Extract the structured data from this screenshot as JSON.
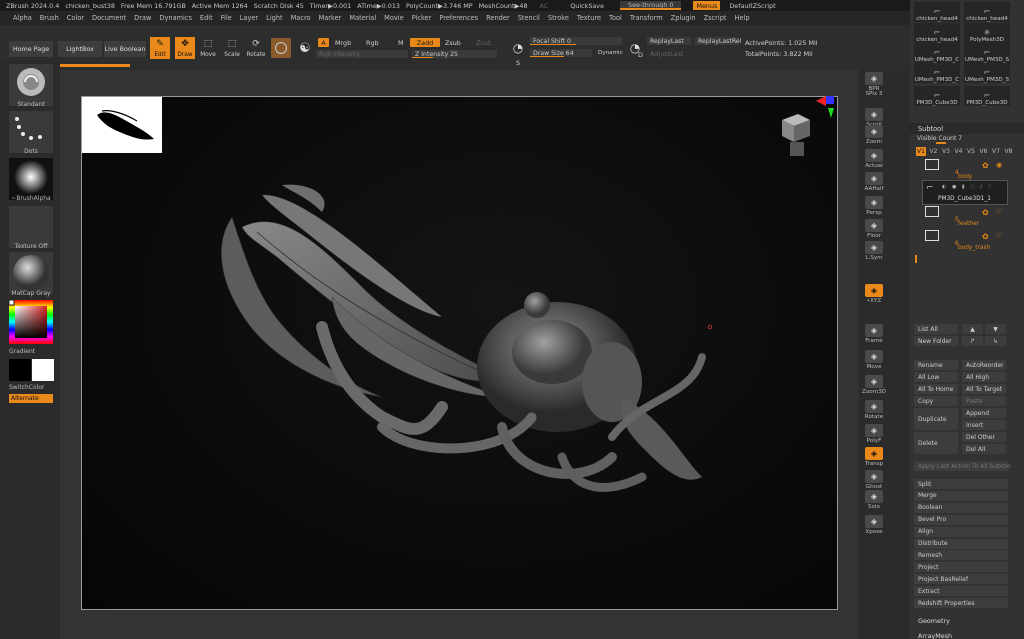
{
  "titlebar": {
    "app": "ZBrush 2024.0.4",
    "file": "chicken_bust38",
    "free_mem": "Free Mem 16.791GB",
    "active_mem": "Active Mem 1264",
    "scratch_disk": "Scratch Disk 45",
    "timer": "Timer▶0.001",
    "atime": "ATime▶0.013",
    "polycount": "PolyCount▶3.746 MP",
    "meshcount": "MeshCount▶48",
    "ac": "AC",
    "quicksave": "QuickSave",
    "seethrough": "See-through   0",
    "menus": "Menus",
    "default_zscript": "DefaultZScript"
  },
  "menubar": [
    "Alpha",
    "Brush",
    "Color",
    "Document",
    "Draw",
    "Dynamics",
    "Edit",
    "File",
    "Layer",
    "Light",
    "Macro",
    "Marker",
    "Material",
    "Movie",
    "Picker",
    "Preferences",
    "Render",
    "Stencil",
    "Stroke",
    "Texture",
    "Tool",
    "Transform",
    "Zplugin",
    "Zscript",
    "Help"
  ],
  "toolbar": {
    "home_page": "Home Page",
    "lightbox": "LightBox",
    "live_boolean": "Live Boolean",
    "edit": "Edit",
    "draw": "Draw",
    "move": "Move",
    "scale": "Scale",
    "rotate": "Rotate",
    "a_label": "A",
    "mrgb": "Mrgb",
    "rgb": "Rgb",
    "m": "M",
    "zadd": "Zadd",
    "zsub": "Zsub",
    "zcut": "Zcut",
    "rgb_intensity": "Rgb Intensity",
    "z_intensity": "Z Intensity 25",
    "focal_shift": "Focal Shift 0",
    "draw_size": "Draw Size 64",
    "dynamic": "Dynamic",
    "s_label": "S",
    "d_label": "D",
    "replay_last": "ReplayLast",
    "replay_last_rel": "ReplayLastRel",
    "adjust_last": "AdjustLast",
    "active_points": "ActivePoints: 1.025 Mil",
    "total_points": "TotalPoints: 3.822 Mil",
    "z_intensity_level": 0.25,
    "focal_shift_level": 0.5,
    "draw_size_level": 0.55
  },
  "leftshelf": {
    "standard": "Standard",
    "dots": "Dots",
    "brush_alpha": "~BrushAlpha",
    "texture_off": "Texture Off",
    "matcap": "MatCap Gray",
    "gradient": "Gradient",
    "switch_color": "SwitchColor",
    "alternate": "Alternate"
  },
  "rightshelf": [
    {
      "name": "bpr",
      "label": "BPR",
      "icon": "sphere-icon"
    },
    {
      "name": "spix",
      "label": "SPix 3",
      "icon": ""
    },
    {
      "name": "scroll",
      "label": "Scroll",
      "icon": "scroll-icon"
    },
    {
      "name": "zoom",
      "label": "Zoom",
      "icon": "zoom-icon"
    },
    {
      "name": "actual",
      "label": "Actual",
      "icon": "actual-icon"
    },
    {
      "name": "aahalf",
      "label": "AAHalf",
      "icon": "aahalf-icon"
    },
    {
      "name": "persp",
      "label": "Persp",
      "icon": "persp-icon"
    },
    {
      "name": "floor",
      "label": "Floor",
      "icon": "floor-icon"
    },
    {
      "name": "lsym",
      "label": "L.Sym",
      "icon": "lsym-icon"
    },
    {
      "name": "xyz",
      "label": "•XYZ",
      "icon": "xyz-icon"
    },
    {
      "name": "frame",
      "label": "Frame",
      "icon": "frame-icon"
    },
    {
      "name": "move",
      "label": "Move",
      "icon": "move-icon"
    },
    {
      "name": "zoom3d",
      "label": "Zoom3D",
      "icon": "zoom3d-icon"
    },
    {
      "name": "rotate",
      "label": "Rotate",
      "icon": "rotate-icon"
    },
    {
      "name": "polyf",
      "label": "PolyF",
      "icon": "polyf-icon"
    },
    {
      "name": "transp",
      "label": "Transp",
      "icon": "transp-icon"
    },
    {
      "name": "ghost",
      "label": "Ghost",
      "icon": "ghost-icon"
    },
    {
      "name": "solo",
      "label": "Solo",
      "icon": "solo-icon"
    },
    {
      "name": "xpose",
      "label": "Xpose",
      "icon": "xpose-icon"
    }
  ],
  "tool_thumbs": [
    {
      "label": "chicken_head4",
      "icon": "tool-icon"
    },
    {
      "label": "chicken_head4",
      "icon": "tool-icon"
    },
    {
      "label": "chicken_head4",
      "icon": "tool-icon"
    },
    {
      "label": "PolyMesh3D",
      "icon": "star-icon"
    },
    {
      "label": "UMesh_PM3D_C",
      "icon": "tool-icon"
    },
    {
      "label": "UMesh_PM3D_S",
      "icon": "tool-icon"
    },
    {
      "label": "UMesh_PM3D_C",
      "icon": "tool-icon"
    },
    {
      "label": "UMesh_PM3D_S",
      "icon": "tool-icon"
    },
    {
      "label": "PM3D_Cube3D",
      "icon": "tool-icon"
    },
    {
      "label": "PM3D_Cube3D",
      "icon": "tool-icon"
    }
  ],
  "subtool": {
    "header": "Subtool",
    "visible_count": "Visible Count 7",
    "versions": [
      "V1",
      "V2",
      "V3",
      "V4",
      "V5",
      "V6",
      "V7",
      "V8"
    ],
    "folders": [
      {
        "num": "4",
        "name": "body"
      },
      {
        "num": "5",
        "name": "feather"
      },
      {
        "num": "6",
        "name": "body_trash"
      }
    ],
    "active_item": "PM3D_Cube3D1_1",
    "list_all": "List All",
    "new_folder": "New Folder",
    "rename": "Rename",
    "autoreorder": "AutoReorder",
    "all_low": "All Low",
    "all_high": "All High",
    "all_to_home": "All To Home",
    "all_to_target": "All To Target",
    "copy": "Copy",
    "paste": "Paste",
    "duplicate": "Duplicate",
    "append": "Append",
    "insert": "Insert",
    "delete": "Delete",
    "del_other": "Del Other",
    "del_all": "Del All",
    "apply_last": "Apply Last Action To All Subtoo",
    "actions": [
      "Split",
      "Merge",
      "Boolean",
      "Bevel Pro",
      "Align",
      "Distribute",
      "Remesh",
      "Project",
      "Project BasRelief",
      "Extract",
      "Redshift Properties"
    ],
    "geometry": "Geometry",
    "arraymesh": "ArrayMesh"
  },
  "colors": {
    "accent": "#e8891a",
    "background": "#2b2b2b",
    "canvas": "#0a0a0a"
  }
}
